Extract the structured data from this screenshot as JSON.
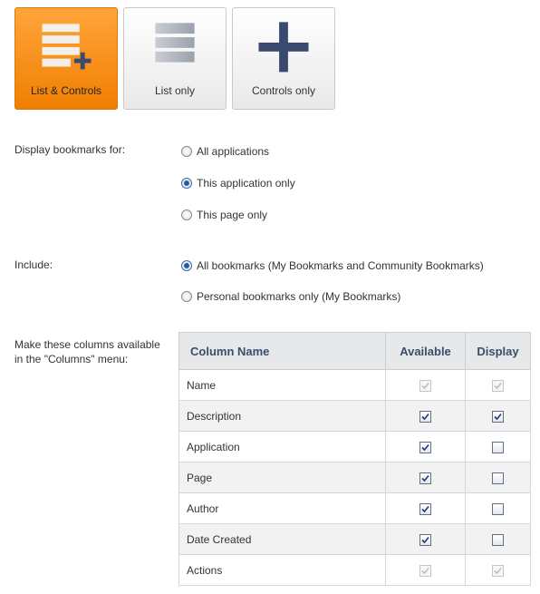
{
  "layout_buttons": {
    "list_controls": "List & Controls",
    "list_only": "List only",
    "controls_only": "Controls only"
  },
  "display_for": {
    "label": "Display bookmarks for:",
    "options": [
      "All applications",
      "This application only",
      "This page only"
    ],
    "selected": "This application only"
  },
  "include": {
    "label": "Include:",
    "options": [
      "All bookmarks (My Bookmarks and Community Bookmarks)",
      "Personal bookmarks only (My Bookmarks)"
    ],
    "selected": "All bookmarks (My Bookmarks and Community Bookmarks)"
  },
  "columns": {
    "label": "Make these columns available in the \"Columns\" menu:",
    "headers": [
      "Column Name",
      "Available",
      "Display"
    ],
    "rows": [
      {
        "name": "Name",
        "available": true,
        "display": true,
        "disabled": true
      },
      {
        "name": "Description",
        "available": true,
        "display": true,
        "disabled": false
      },
      {
        "name": "Application",
        "available": true,
        "display": false,
        "disabled": false
      },
      {
        "name": "Page",
        "available": true,
        "display": false,
        "disabled": false
      },
      {
        "name": "Author",
        "available": true,
        "display": false,
        "disabled": false
      },
      {
        "name": "Date Created",
        "available": true,
        "display": false,
        "disabled": false
      },
      {
        "name": "Actions",
        "available": true,
        "display": true,
        "disabled": true
      }
    ]
  },
  "colors": {
    "accent_orange": "#f38a0c",
    "icon_navy": "#3a4a6e",
    "radio_blue": "#1f5fa8"
  },
  "icons": [
    "list-plus-icon",
    "list-icon",
    "plus-icon",
    "checkmark-icon"
  ]
}
